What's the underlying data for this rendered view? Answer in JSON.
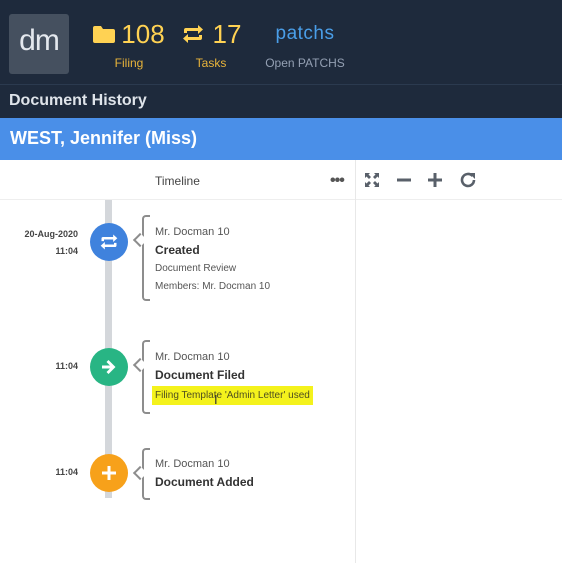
{
  "header": {
    "logo_text": "dm",
    "filing": {
      "count": "108",
      "label": "Filing"
    },
    "tasks": {
      "count": "17",
      "label": "Tasks"
    },
    "patchs": {
      "logo": "patchs",
      "label": "Open PATCHS"
    }
  },
  "history": {
    "title": "Document History"
  },
  "patient": {
    "name": "WEST, Jennifer (Miss)"
  },
  "toolbar": {
    "timeline_heading": "Timeline",
    "more": "•••",
    "tools": [
      "expand-icon",
      "zoom-out-icon",
      "zoom-in-icon",
      "refresh-icon"
    ]
  },
  "colors": {
    "created": "#3f82dd",
    "filed": "#28b584",
    "added": "#f7a11a",
    "highlight": "#f4f21c"
  },
  "events": [
    {
      "date": "20-Aug-2020",
      "time": "11:04",
      "author": "Mr. Docman 10",
      "title": "Created",
      "details": [
        "Document Review",
        "Members: Mr. Docman 10"
      ],
      "icon": "repeat-icon"
    },
    {
      "date": "",
      "time": "11:04",
      "author": "Mr. Docman 10",
      "title": "Document Filed",
      "details": [
        "Filing Template 'Admin Letter' used"
      ],
      "icon": "arrow-right-icon"
    },
    {
      "date": "",
      "time": "11:04",
      "author": "Mr. Docman 10",
      "title": "Document Added",
      "details": [],
      "icon": "plus-icon"
    }
  ]
}
